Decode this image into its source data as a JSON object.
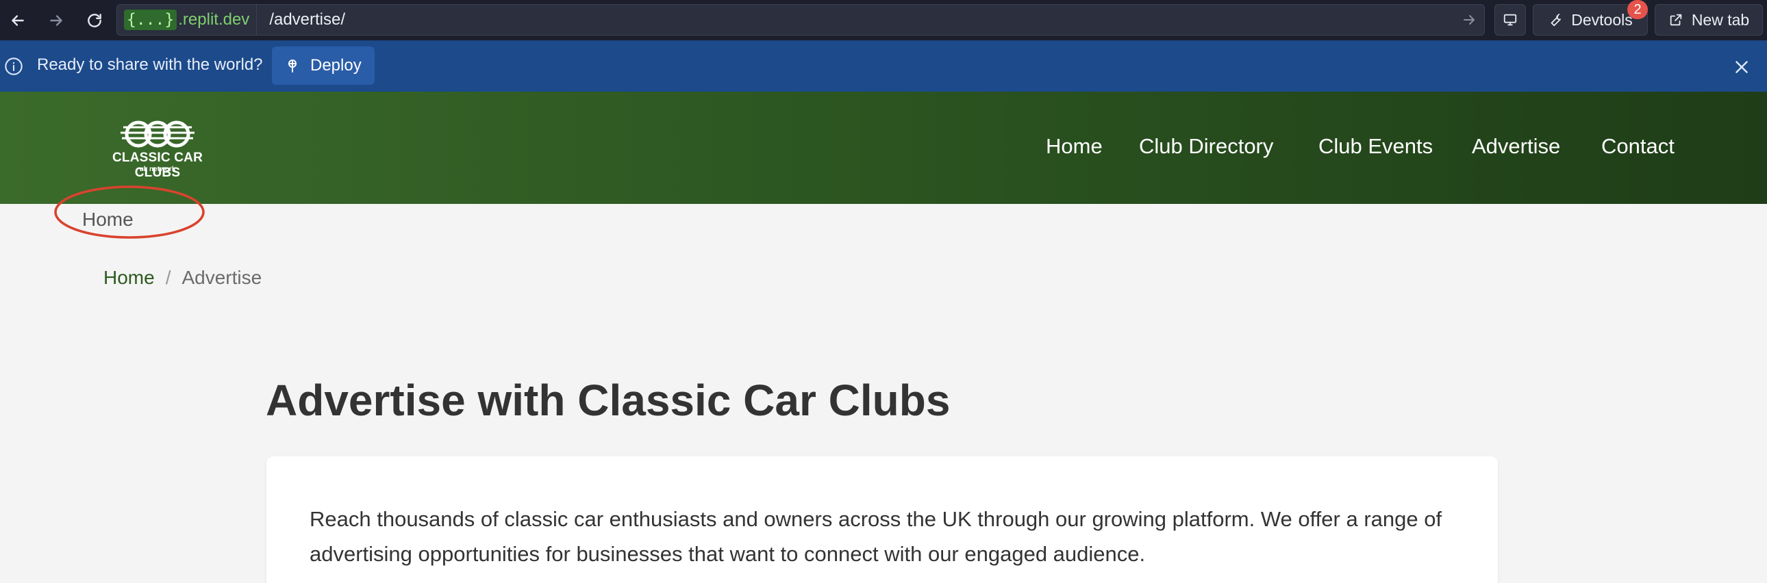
{
  "browser": {
    "url_braces": "{...}",
    "url_domain": ".replit.dev",
    "url_path": "/advertise/",
    "devtools_label": "Devtools",
    "devtools_badge": "2",
    "new_tab_label": "New tab"
  },
  "banner": {
    "message": "Ready to share with the world?",
    "deploy_label": "Deploy",
    "background": "#1c4a8a"
  },
  "site": {
    "logo_text": "CLASSIC CAR CLUBS",
    "logo_sub": "uk network",
    "nav": [
      {
        "label": "Home"
      },
      {
        "label": "Club Directory"
      },
      {
        "label": "Club Events"
      },
      {
        "label": "Advertise"
      },
      {
        "label": "Contact"
      }
    ],
    "header_color": "#2b5420"
  },
  "page": {
    "home_overlay": "Home",
    "breadcrumb": {
      "home": "Home",
      "separator": "/",
      "current": "Advertise"
    },
    "title": "Advertise with Classic Car Clubs",
    "intro": "Reach thousands of classic car enthusiasts and owners across the UK through our growing platform. We offer a range of advertising opportunities for businesses that want to connect with our engaged audience."
  }
}
